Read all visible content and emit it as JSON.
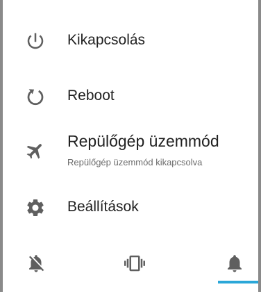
{
  "power_menu": {
    "items": [
      {
        "title": "Kikapcsolás",
        "icon": "power-icon"
      },
      {
        "title": "Reboot",
        "icon": "reboot-icon"
      },
      {
        "title": "Repülőgép üzemmód",
        "subtitle": "Repülőgép üzemmód kikapcsolva",
        "icon": "airplane-icon"
      },
      {
        "title": "Beállítások",
        "icon": "gear-icon"
      }
    ]
  },
  "sound_modes": {
    "items": [
      {
        "icon": "bell-off-icon",
        "selected": false
      },
      {
        "icon": "vibrate-icon",
        "selected": false
      },
      {
        "icon": "bell-icon",
        "selected": true
      }
    ],
    "accent_color": "#2aa7d8",
    "icon_color": "#5f5f5f"
  }
}
